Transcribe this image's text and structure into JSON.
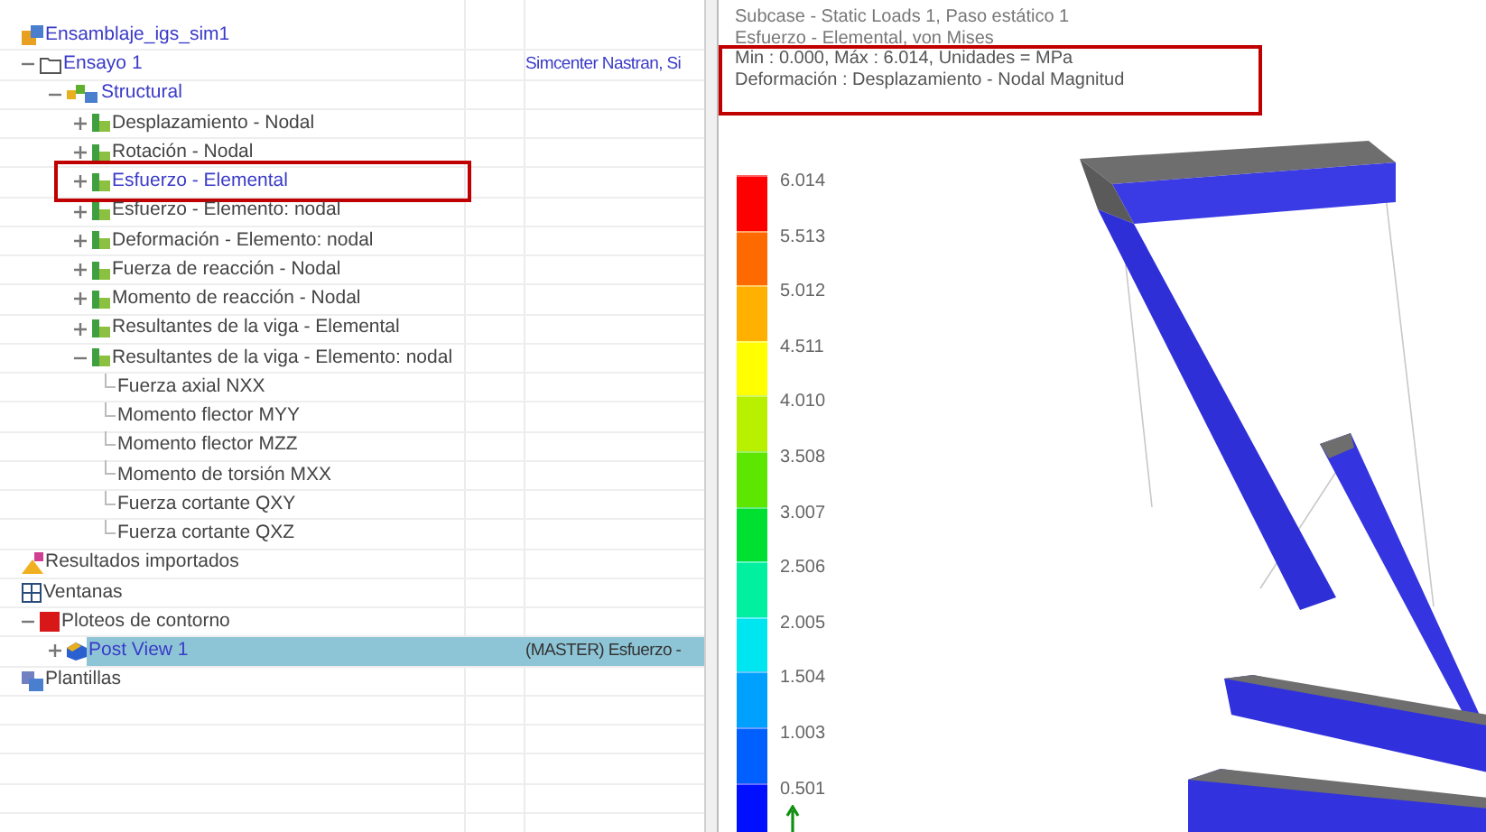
{
  "tree": {
    "items": [
      {
        "label": "Ensamblaje_igs_sim1",
        "kind": "simulation",
        "active": true,
        "selected": false,
        "highlighted": false
      },
      {
        "label": "Ensayo 1",
        "kind": "solution",
        "expanded": true,
        "active": true,
        "selected": false,
        "highlighted": false,
        "column_3": "Simcenter Nastran, Si",
        "children": [
          {
            "label": "Structural",
            "kind": "group",
            "expanded": true,
            "active": true,
            "selected": false,
            "highlighted": false,
            "children": [
              {
                "label": "Desplazamiento - Nodal",
                "kind": "result",
                "expanded": false,
                "active": false,
                "selected": false,
                "highlighted": false
              },
              {
                "label": "Rotación - Nodal",
                "kind": "result",
                "expanded": false,
                "active": false,
                "selected": false,
                "highlighted": false
              },
              {
                "label": "Esfuerzo - Elemental",
                "kind": "result",
                "expanded": false,
                "active": true,
                "selected": false,
                "highlighted": true
              },
              {
                "label": "Esfuerzo - Elemento: nodal",
                "kind": "result",
                "expanded": false,
                "active": false,
                "selected": false,
                "highlighted": false
              },
              {
                "label": "Deformación - Elemento: nodal",
                "kind": "result",
                "expanded": false,
                "active": false,
                "selected": false,
                "highlighted": false
              },
              {
                "label": "Fuerza de reacción - Nodal",
                "kind": "result",
                "expanded": false,
                "active": false,
                "selected": false,
                "highlighted": false
              },
              {
                "label": "Momento de reacción - Nodal",
                "kind": "result",
                "expanded": false,
                "active": false,
                "selected": false,
                "highlighted": false
              },
              {
                "label": "Resultantes de la viga - Elemental",
                "kind": "result",
                "expanded": false,
                "active": false,
                "selected": false,
                "highlighted": false
              },
              {
                "label": "Resultantes de la viga - Elemento: nodal",
                "kind": "result",
                "expanded": true,
                "active": false,
                "selected": false,
                "highlighted": false,
                "children": [
                  {
                    "label": "Fuerza axial NXX",
                    "kind": "component",
                    "active": false,
                    "selected": false,
                    "highlighted": false
                  },
                  {
                    "label": "Momento flector MYY",
                    "kind": "component",
                    "active": false,
                    "selected": false,
                    "highlighted": false
                  },
                  {
                    "label": "Momento flector MZZ",
                    "kind": "component",
                    "active": false,
                    "selected": false,
                    "highlighted": false
                  },
                  {
                    "label": "Momento de torsión MXX",
                    "kind": "component",
                    "active": false,
                    "selected": false,
                    "highlighted": false
                  },
                  {
                    "label": "Fuerza cortante QXY",
                    "kind": "component",
                    "active": false,
                    "selected": false,
                    "highlighted": false
                  },
                  {
                    "label": "Fuerza cortante QXZ",
                    "kind": "component",
                    "active": false,
                    "selected": false,
                    "highlighted": false
                  }
                ]
              }
            ]
          }
        ]
      },
      {
        "label": "Resultados importados",
        "kind": "imported",
        "active": false,
        "selected": false,
        "highlighted": false
      },
      {
        "label": "Ventanas",
        "kind": "windows",
        "active": false,
        "selected": false,
        "highlighted": false
      },
      {
        "label": "Ploteos de contorno",
        "kind": "plots",
        "expanded": true,
        "active": false,
        "selected": false,
        "highlighted": false,
        "children": [
          {
            "label": "Post View 1",
            "kind": "view",
            "expanded": false,
            "active": true,
            "selected": true,
            "highlighted": false,
            "column_3": "(MASTER) Esfuerzo -"
          }
        ]
      },
      {
        "label": "Plantillas",
        "kind": "templates",
        "active": false,
        "selected": false,
        "highlighted": false
      }
    ]
  },
  "viewport": {
    "info_lines": [
      {
        "text": "Subcase - Static Loads 1, Paso estático 1",
        "highlighted": false
      },
      {
        "text": "Esfuerzo - Elemental, von Mises",
        "highlighted": false
      },
      {
        "text": "Min : 0.000, Máx : 6.014, Unidades = MPa",
        "highlighted": true
      },
      {
        "text": "Deformación : Desplazamiento - Nodal Magnitud",
        "highlighted": true
      }
    ],
    "legend": [
      {
        "label": "6.014",
        "color": "#ff0000"
      },
      {
        "label": "5.513",
        "color": "#ff6a00"
      },
      {
        "label": "5.012",
        "color": "#ffb000"
      },
      {
        "label": "4.511",
        "color": "#ffff00"
      },
      {
        "label": "4.010",
        "color": "#b8f000"
      },
      {
        "label": "3.508",
        "color": "#5ce600"
      },
      {
        "label": "3.007",
        "color": "#00e030"
      },
      {
        "label": "2.506",
        "color": "#00f0a0"
      },
      {
        "label": "2.005",
        "color": "#00e6f0"
      },
      {
        "label": "1.504",
        "color": "#00a0ff"
      },
      {
        "label": "1.003",
        "color": "#0060ff"
      },
      {
        "label": "0.501",
        "color": "#0010ff"
      }
    ]
  }
}
